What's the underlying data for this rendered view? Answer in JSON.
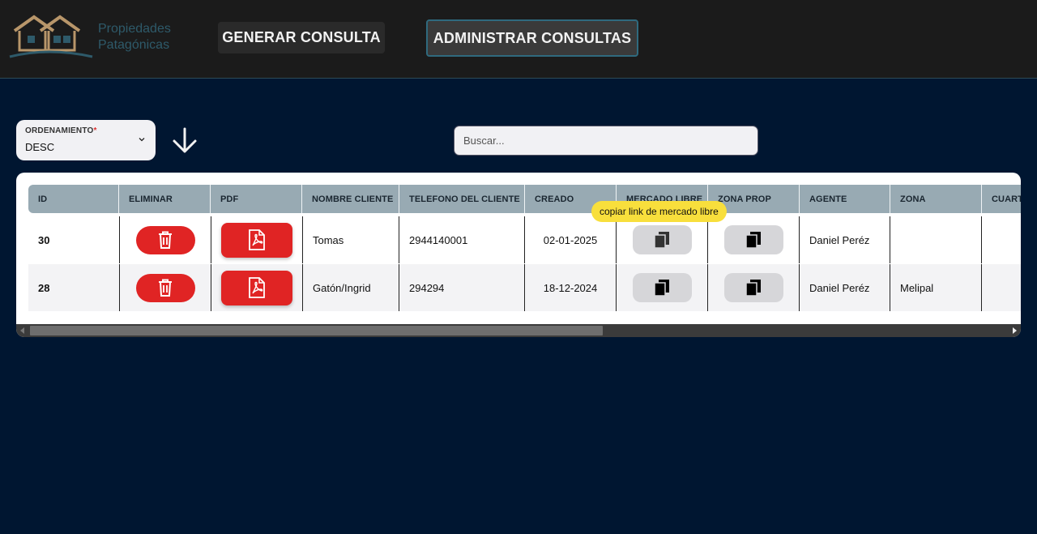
{
  "header": {
    "logo_line1": "Propiedades",
    "logo_line2": "Patagónicas",
    "nav": [
      {
        "label": "GENERAR CONSULTA"
      },
      {
        "label": "ADMINISTRAR CONSULTAS"
      }
    ]
  },
  "controls": {
    "ordering_label": "ORDENAMIENTO",
    "ordering_required_mark": "*",
    "ordering_value": "DESC",
    "search_placeholder": "Buscar..."
  },
  "table": {
    "columns": [
      "ID",
      "ELIMINAR",
      "PDF",
      "NOMBRE CLIENTE",
      "TELEFONO DEL CLIENTE",
      "CREADO",
      "MERCADO LIBRE",
      "ZONA PROP",
      "AGENTE",
      "ZONA",
      "CUARTOS"
    ],
    "rows": [
      {
        "id": "30",
        "nombre": "Tomas",
        "telefono": "2944140001",
        "creado": "02-01-2025",
        "agente": "Daniel Peréz",
        "zona": ""
      },
      {
        "id": "28",
        "nombre": "Gatón/Ingrid",
        "telefono": "294294",
        "creado": "18-12-2024",
        "agente": "Daniel Peréz",
        "zona": "Melipal"
      }
    ]
  },
  "tooltip": "copiar link de mercado libre",
  "colors": {
    "background": "#001631",
    "header": "#1b1b1b",
    "delete_red": "#e02424",
    "table_header": "#98aab3",
    "tooltip_yellow": "#f8df3c"
  },
  "icons": {
    "delete": "trash-icon",
    "pdf": "pdf-icon",
    "copy": "copy-icon",
    "sort": "arrow-down-icon",
    "select": "chevron-down-icon"
  }
}
